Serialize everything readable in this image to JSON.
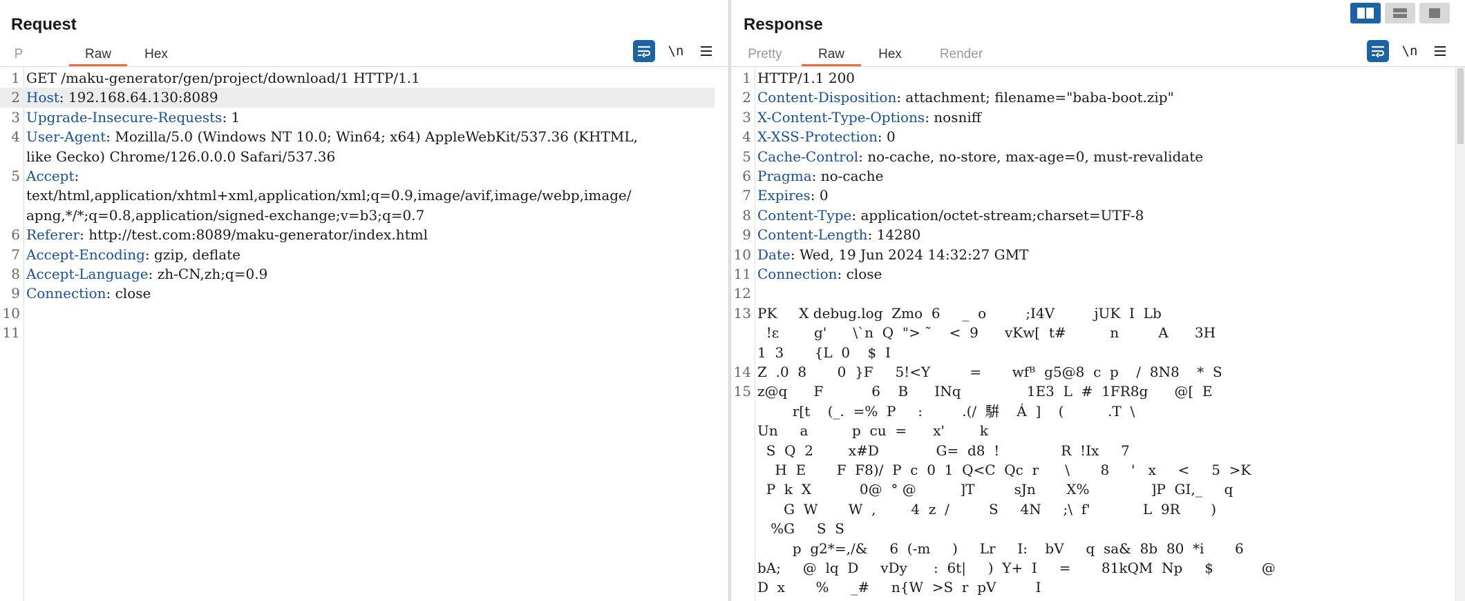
{
  "request": {
    "title": "Request",
    "tabs": [
      "P",
      "Raw",
      "Hex"
    ],
    "active_tab": "Raw",
    "newline_label": "\\n",
    "lines": [
      {
        "n": "1",
        "key": "",
        "text": "GET /maku-generator/gen/project/download/1 HTTP/1.1"
      },
      {
        "n": "2",
        "key": "Host",
        "text": ": 192.168.64.130:8089"
      },
      {
        "n": "3",
        "key": "Upgrade-Insecure-Requests",
        "text": ": 1"
      },
      {
        "n": "4",
        "key": "User-Agent",
        "text": ": Mozilla/5.0 (Windows NT 10.0; Win64; x64) AppleWebKit/537.36 (KHTML,"
      },
      {
        "n": "",
        "key": "",
        "text": "like Gecko) Chrome/126.0.0.0 Safari/537.36"
      },
      {
        "n": "5",
        "key": "Accept",
        "text": ":"
      },
      {
        "n": "",
        "key": "",
        "text": "text/html,application/xhtml+xml,application/xml;q=0.9,image/avif,image/webp,image/"
      },
      {
        "n": "",
        "key": "",
        "text": "apng,*/*;q=0.8,application/signed-exchange;v=b3;q=0.7"
      },
      {
        "n": "6",
        "key": "Referer",
        "text": ": http://test.com:8089/maku-generator/index.html"
      },
      {
        "n": "7",
        "key": "Accept-Encoding",
        "text": ": gzip, deflate"
      },
      {
        "n": "8",
        "key": "Accept-Language",
        "text": ": zh-CN,zh;q=0.9"
      },
      {
        "n": "9",
        "key": "Connection",
        "text": ": close"
      },
      {
        "n": "10",
        "key": "",
        "text": ""
      },
      {
        "n": "11",
        "key": "",
        "text": ""
      }
    ]
  },
  "response": {
    "title": "Response",
    "tabs": [
      "Pretty",
      "Raw",
      "Hex",
      "Render"
    ],
    "active_tab": "Raw",
    "newline_label": "\\n",
    "lines": [
      {
        "n": "1",
        "key": "",
        "text": "HTTP/1.1 200"
      },
      {
        "n": "2",
        "key": "Content-Disposition",
        "text": ": attachment; filename=\"baba-boot.zip\""
      },
      {
        "n": "3",
        "key": "X-Content-Type-Options",
        "text": ": nosniff"
      },
      {
        "n": "4",
        "key": "X-XSS-Protection",
        "text": ": 0"
      },
      {
        "n": "5",
        "key": "Cache-Control",
        "text": ": no-cache, no-store, max-age=0, must-revalidate"
      },
      {
        "n": "6",
        "key": "Pragma",
        "text": ": no-cache"
      },
      {
        "n": "7",
        "key": "Expires",
        "text": ": 0"
      },
      {
        "n": "8",
        "key": "Content-Type",
        "text": ": application/octet-stream;charset=UTF-8"
      },
      {
        "n": "9",
        "key": "Content-Length",
        "text": ": 14280"
      },
      {
        "n": "10",
        "key": "Date",
        "text": ": Wed, 19 Jun 2024 14:32:27 GMT"
      },
      {
        "n": "11",
        "key": "Connection",
        "text": ": close"
      },
      {
        "n": "12",
        "key": "",
        "text": ""
      },
      {
        "n": "13",
        "key": "",
        "text": "PK     X debug.log  Zmo  6     _  o         ;I4V         jUK  I  Lb"
      },
      {
        "n": "",
        "key": "",
        "text": "  !ε        g'      \\`n  Q  \"> ˜    <  9      vKw[  t#          n         A      3H"
      },
      {
        "n": "",
        "key": "",
        "text": "1  3       {L  0    $  I"
      },
      {
        "n": "14",
        "key": "",
        "text": "Z  .0  8       0  }F     5!<Y         =       wfᴮ  g5@8  c  p    /  8N8    *  S"
      },
      {
        "n": "15",
        "key": "",
        "text": "z@q      F           6    B      INq               1E3  L  #  1FR8g      @[  E"
      },
      {
        "n": "",
        "key": "",
        "text": "        r[t    (_.  =%  P     :         .(/  騈    Á  ]    (          .T  \\"
      },
      {
        "n": "",
        "key": "",
        "text": "Un     a          p  cu  =      x'        k"
      },
      {
        "n": "",
        "key": "",
        "text": "  S  Q  2        x#D             G=  d8  !              R  !Ix     7"
      },
      {
        "n": "",
        "key": "",
        "text": "    H  E       F  F8)/  P  c  0  1  Q<C  Qc  r      \\       8     '   x     <     5  >K"
      },
      {
        "n": "",
        "key": "",
        "text": "  P  k  X           0@  ° @          ]T         sJn       X%              ]P  GI,_     q"
      },
      {
        "n": "",
        "key": "",
        "text": "      G  W       W  ,        4  z  /         S     4N     ;\\  f'            L  9R       )"
      },
      {
        "n": "",
        "key": "",
        "text": "   %G     S  S"
      },
      {
        "n": "",
        "key": "",
        "text": "        p  g2*=,/&     6  (-m     )     Lr     I:    bV     q  sa&  8b  80  *i       6"
      },
      {
        "n": "",
        "key": "",
        "text": "bA;     @  lq  D     vDy      :  6t|     )  Y+  I     =       81kQM  Np     $           @"
      },
      {
        "n": "",
        "key": "",
        "text": "D  x       %     _#     n{W  >S  r  pV         I"
      }
    ]
  },
  "icons": {
    "wrap": "wrap-lines-icon",
    "menu": "hamburger-menu-icon",
    "layout_side": "layout-side-by-side-icon",
    "layout_stacked": "layout-stacked-icon",
    "layout_single": "layout-single-icon"
  },
  "colors": {
    "accent": "#1c63a6",
    "tab_underline": "#ef6b3a",
    "header_key": "#1450a3"
  }
}
